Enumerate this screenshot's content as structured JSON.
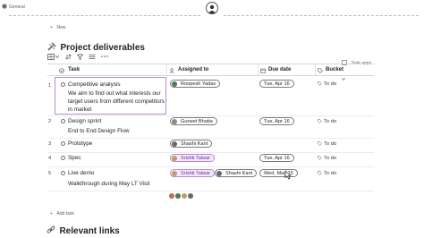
{
  "header": {
    "breadcrumb": "General",
    "new_label": "New"
  },
  "section_title": "Project deliverables",
  "toolbar": {
    "task_apps_label": "Task apps"
  },
  "columns": {
    "task": "Task",
    "assigned": "Assigned to",
    "due": "Due date",
    "bucket": "Bucket"
  },
  "rows": [
    {
      "num": "1",
      "title": "Competitive analysis",
      "desc_lines": [
        "We aim to find out what interests our",
        "target users from different competitors",
        "in market"
      ],
      "assignees": [
        "Roopesh Yadav"
      ],
      "due": "Tue, Apr 16",
      "bucket": "To do"
    },
    {
      "num": "2",
      "title": "Design sprint",
      "desc_lines": [
        "End to End Design Flow"
      ],
      "assignees": [
        "Guneet Bhatia"
      ],
      "due": "Tue, Apr 16",
      "bucket": "To do"
    },
    {
      "num": "3",
      "title": "Prototype",
      "desc_lines": [],
      "assignees": [
        "Shashi Kant"
      ],
      "due": "",
      "bucket": "To do"
    },
    {
      "num": "4",
      "title": "Spec",
      "desc_lines": [],
      "assignees": [
        "Srishti Talwar"
      ],
      "due": "Tue, Apr 16",
      "bucket": "To do"
    },
    {
      "num": "5",
      "title": "Live demo",
      "desc_lines": [
        "Walkthrough during May LT Visit"
      ],
      "assignees": [
        "Srishti Talwar",
        "Shashi Kant"
      ],
      "due": "Wed, May 15",
      "bucket": "To do"
    }
  ],
  "add_task_label": "Add task",
  "footer_section_title": "Relevant links",
  "colors": {
    "accent": "#b48ad6",
    "chip_purple_bg": "#f3e9fb"
  }
}
